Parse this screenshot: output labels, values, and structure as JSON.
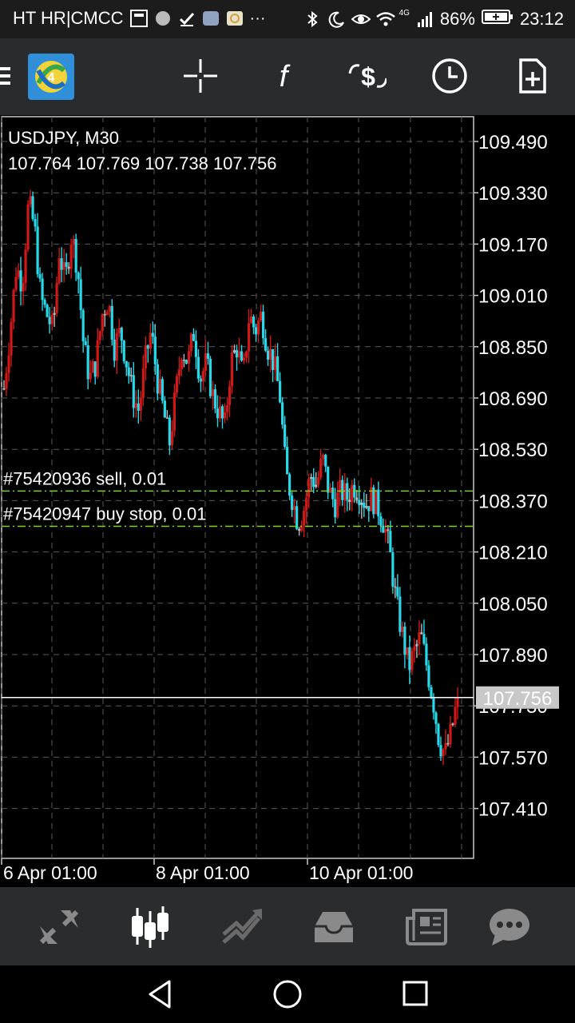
{
  "status_bar": {
    "carrier": "HT HR|CMCC",
    "ellipsis": "···",
    "network": "4G",
    "battery": "86%",
    "time": "23:12",
    "icons": [
      "notification-icon",
      "circle-icon",
      "check-icon",
      "photo-icon",
      "app-icon",
      "bluetooth-icon",
      "moon-icon",
      "eye-icon",
      "wifi-icon",
      "signal-icon",
      "battery-icon"
    ]
  },
  "toolbar": {
    "icons": [
      "menu-icon",
      "metatrader-logo",
      "crosshair-icon",
      "indicators-icon",
      "symbol-change-icon",
      "timeframe-icon",
      "new-order-icon"
    ]
  },
  "chart": {
    "symbol": "USDJPY, M30",
    "ohlc": "107.764 107.769 107.738 107.756",
    "order_sell": "#75420936 sell, 0.01",
    "order_buy_stop": "#75420947 buy stop, 0.01",
    "current_price": "107.756",
    "price_levels": [
      "109.490",
      "109.330",
      "109.170",
      "109.010",
      "108.850",
      "108.690",
      "108.530",
      "108.370",
      "108.210",
      "108.050",
      "107.890",
      "107.730",
      "107.570",
      "107.410"
    ],
    "time_labels": [
      "6 Apr 01:00",
      "8 Apr 01:00",
      "10 Apr 01:00"
    ],
    "colors": {
      "bull": "#d01818",
      "bear": "#28d8e8",
      "neutral": "#b8b8b8",
      "order_line": "#7ed321",
      "bid_line": "#ffffff"
    }
  },
  "chart_data": {
    "type": "candlestick",
    "title": "USDJPY, M30",
    "ylim": [
      107.33,
      109.57
    ],
    "x_ticks": [
      "6 Apr 01:00",
      "8 Apr 01:00",
      "10 Apr 01:00"
    ],
    "ticks": [
      "109.490",
      "109.330",
      "109.170",
      "109.010",
      "108.850",
      "108.690",
      "108.530",
      "108.370",
      "108.210",
      "108.050",
      "107.890",
      "107.730",
      "107.570",
      "107.410"
    ],
    "close_path": [
      108.72,
      108.9,
      109.1,
      109.05,
      109.3,
      109.22,
      109.0,
      108.95,
      108.9,
      109.15,
      109.05,
      109.2,
      109.1,
      108.85,
      108.75,
      108.8,
      108.95,
      109.0,
      108.85,
      108.9,
      108.8,
      108.7,
      108.65,
      108.8,
      108.9,
      108.75,
      108.65,
      108.55,
      108.7,
      108.85,
      108.8,
      108.9,
      108.75,
      108.8,
      108.7,
      108.65,
      108.6,
      108.8,
      108.85,
      108.75,
      108.95,
      108.9,
      108.95,
      108.85,
      108.8,
      108.7,
      108.45,
      108.38,
      108.3,
      108.35,
      108.45,
      108.42,
      108.5,
      108.4,
      108.36,
      108.4,
      108.38,
      108.42,
      108.4,
      108.36,
      108.38,
      108.35,
      108.3,
      108.2,
      108.05,
      107.95,
      107.85,
      107.9,
      107.95,
      107.85,
      107.75,
      107.62,
      107.58,
      107.65,
      107.756
    ],
    "current": 107.756,
    "orders": [
      {
        "label": "#75420936 sell, 0.01",
        "price": 108.4
      },
      {
        "label": "#75420947 buy stop, 0.01",
        "price": 108.29
      }
    ]
  },
  "bottom_nav": {
    "items": [
      "quotes-icon",
      "chart-icon",
      "trade-icon",
      "history-icon",
      "news-icon",
      "chat-icon"
    ],
    "active": "chart-icon"
  },
  "system_nav": [
    "back-icon",
    "home-icon",
    "recents-icon"
  ]
}
